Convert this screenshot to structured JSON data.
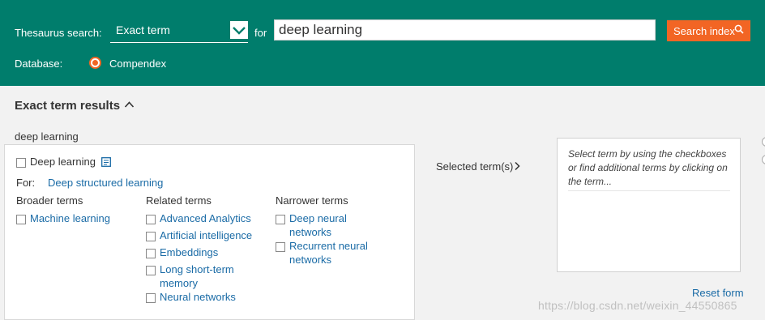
{
  "header": {
    "search_type_label": "Thesaurus search:",
    "search_type_value": "Exact term",
    "for_label": "for",
    "query_value": "deep learning",
    "search_button_label": "Search index",
    "database_label": "Database:",
    "database_option": "Compendex",
    "colors": {
      "bar": "#007d6c",
      "accent": "#f26524"
    }
  },
  "results": {
    "title": "Exact term results",
    "query_label": "deep learning",
    "main_term": "Deep learning",
    "for_label": "For:",
    "for_term": "Deep structured learning",
    "columns": {
      "broader": {
        "header": "Broader terms",
        "items": [
          "Machine learning"
        ]
      },
      "related": {
        "header": "Related terms",
        "items": [
          "Advanced Analytics",
          "Artificial intelligence",
          "Embeddings",
          [
            "Long short-term",
            "memory"
          ],
          "Neural networks"
        ]
      },
      "narrower": {
        "header": "Narrower terms",
        "items": [
          [
            "Deep neural",
            "networks"
          ],
          [
            "Recurrent neural",
            "networks"
          ]
        ]
      }
    }
  },
  "selected": {
    "label": "Selected term(s)",
    "hint_lines": [
      "Select term by using the checkboxes",
      "or find additional terms by clicking on",
      "the term..."
    ],
    "reset_label": "Reset form"
  },
  "watermark": "https://blog.csdn.net/weixin_44550865"
}
